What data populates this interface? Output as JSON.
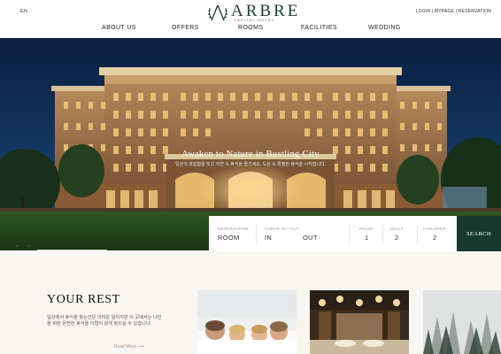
{
  "header": {
    "lang": "EN",
    "logo_text": "ARBRE",
    "logo_sub": "CAPITAL HOTEL",
    "util_links": "LOGIN | MYPAGE | RESERVATION",
    "nav": [
      "ABOUT US",
      "OFFERS",
      "ROOMS",
      "FACILITIES",
      "WEDDING"
    ]
  },
  "hero": {
    "title": "Awaken to Nature in Bustling City",
    "subtitle": "일상의 복잡함을 잊고 자연 속 휴식을 즐기세요. 도심 속 특별한 휴식을 시작합니다."
  },
  "booking": {
    "reservation_label": "RESERVATION",
    "reservation_value": "ROOM",
    "checkin_label": "CHECK IN / OUT",
    "checkin_value": "IN",
    "checkout_value": "OUT",
    "room_label": "ROOM",
    "room_value": "1",
    "adult_label": "ADULT",
    "adult_value": "2",
    "children_label": "CHILDREN",
    "children_value": "2",
    "search_label": "SEARCH"
  },
  "slider": {
    "prev": "←",
    "next": "→",
    "progress": 0.25
  },
  "rest": {
    "title": "YOUR REST",
    "desc": "일상에서 휴식을 찾는건은 어려운 일이지만 이 곳에서는 나만을 위한 온전한 휴식을 어렵지 않게 찾으실 수 있습니다.",
    "more": "Read More"
  },
  "colors": {
    "brand_green": "#163a2e",
    "accent_gold": "#a8927a",
    "section_bg": "#f8f6f1"
  }
}
